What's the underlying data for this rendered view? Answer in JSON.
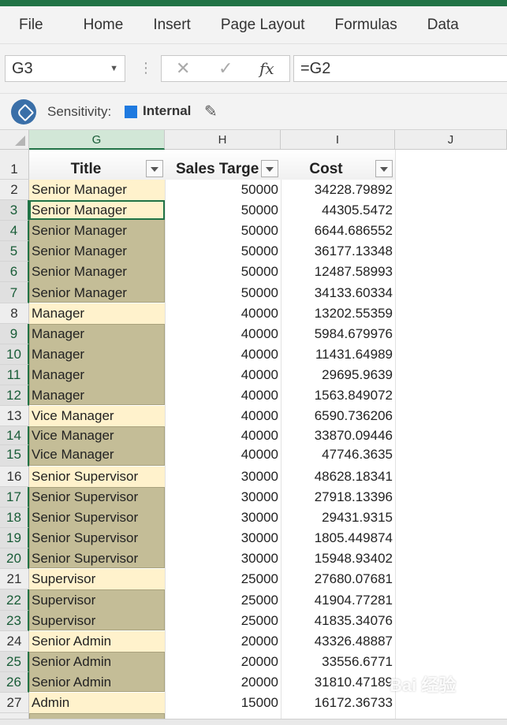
{
  "ribbon": {
    "tabs": [
      {
        "label": "File"
      },
      {
        "label": "Home"
      },
      {
        "label": "Insert"
      },
      {
        "label": "Page Layout"
      },
      {
        "label": "Formulas"
      },
      {
        "label": "Data"
      }
    ]
  },
  "formula_bar": {
    "name_box": "G3",
    "formula": "=G2",
    "cancel_icon": "close-icon",
    "enter_icon": "check-icon",
    "function_icon": "fx"
  },
  "sensitivity": {
    "label": "Sensitivity:",
    "value": "Internal",
    "square_color": "#1f7ae0"
  },
  "columns": [
    {
      "letter": "G"
    },
    {
      "letter": "H"
    },
    {
      "letter": "I"
    },
    {
      "letter": "J"
    }
  ],
  "headers": {
    "title": "Title",
    "sales_target": "Sales Targe",
    "cost": "Cost"
  },
  "rows": [
    {
      "num": "1"
    },
    {
      "num": "2",
      "title": "Senior Manager",
      "target": "50000",
      "cost": "34228.79892"
    },
    {
      "num": "3",
      "title": "Senior Manager",
      "target": "50000",
      "cost": "44305.5472"
    },
    {
      "num": "4",
      "title": "Senior Manager",
      "target": "50000",
      "cost": "6644.686552"
    },
    {
      "num": "5",
      "title": "Senior Manager",
      "target": "50000",
      "cost": "36177.13348"
    },
    {
      "num": "6",
      "title": "Senior Manager",
      "target": "50000",
      "cost": "12487.58993"
    },
    {
      "num": "7",
      "title": "Senior Manager",
      "target": "50000",
      "cost": "34133.60334"
    },
    {
      "num": "8",
      "title": "Manager",
      "target": "40000",
      "cost": "13202.55359"
    },
    {
      "num": "9",
      "title": "Manager",
      "target": "40000",
      "cost": "5984.679976"
    },
    {
      "num": "10",
      "title": "Manager",
      "target": "40000",
      "cost": "11431.64989"
    },
    {
      "num": "11",
      "title": "Manager",
      "target": "40000",
      "cost": "29695.9639"
    },
    {
      "num": "12",
      "title": "Manager",
      "target": "40000",
      "cost": "1563.849072"
    },
    {
      "num": "13",
      "title": "Vice Manager",
      "target": "40000",
      "cost": "6590.736206"
    },
    {
      "num": "14",
      "title": "Vice Manager",
      "target": "40000",
      "cost": "33870.09446"
    },
    {
      "num": "15",
      "title": "Vice Manager",
      "target": "40000",
      "cost": "47746.3635"
    },
    {
      "num": "16",
      "title": "Senior Supervisor",
      "target": "30000",
      "cost": "48628.18341"
    },
    {
      "num": "17",
      "title": "Senior Supervisor",
      "target": "30000",
      "cost": "27918.13396"
    },
    {
      "num": "18",
      "title": "Senior Supervisor",
      "target": "30000",
      "cost": "29431.9315"
    },
    {
      "num": "19",
      "title": "Senior Supervisor",
      "target": "30000",
      "cost": "1805.449874"
    },
    {
      "num": "20",
      "title": "Senior Supervisor",
      "target": "30000",
      "cost": "15948.93402"
    },
    {
      "num": "21",
      "title": "Supervisor",
      "target": "25000",
      "cost": "27680.07681"
    },
    {
      "num": "22",
      "title": "Supervisor",
      "target": "25000",
      "cost": "41904.77281"
    },
    {
      "num": "23",
      "title": "Supervisor",
      "target": "25000",
      "cost": "41835.34076"
    },
    {
      "num": "24",
      "title": "Senior Admin",
      "target": "20000",
      "cost": "43326.48887"
    },
    {
      "num": "25",
      "title": "Senior Admin",
      "target": "20000",
      "cost": "33556.6771"
    },
    {
      "num": "26",
      "title": "Senior Admin",
      "target": "20000",
      "cost": "31810.47189"
    },
    {
      "num": "27",
      "title": "Admin",
      "target": "15000",
      "cost": "16172.36733"
    }
  ],
  "watermark": "Bai 经验",
  "colors": {
    "excel_green": "#217346",
    "header_fill": "#fff2cc",
    "band_fill": "#c4bd97"
  }
}
